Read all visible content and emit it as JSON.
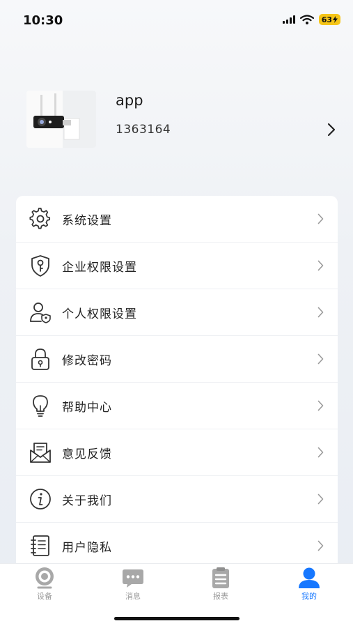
{
  "status_bar": {
    "time": "10:30",
    "battery": "63"
  },
  "profile": {
    "name": "app",
    "id": "1363164"
  },
  "menu": [
    {
      "label": "系统设置",
      "icon": "gear-icon"
    },
    {
      "label": "企业权限设置",
      "icon": "shield-key-icon"
    },
    {
      "label": "个人权限设置",
      "icon": "user-shield-icon"
    },
    {
      "label": "修改密码",
      "icon": "lock-icon"
    },
    {
      "label": "帮助中心",
      "icon": "lightbulb-icon"
    },
    {
      "label": "意见反馈",
      "icon": "mail-feedback-icon"
    },
    {
      "label": "关于我们",
      "icon": "info-icon"
    },
    {
      "label": "用户隐私",
      "icon": "notebook-icon"
    }
  ],
  "tabs": [
    {
      "label": "设备",
      "icon": "camera-icon",
      "active": false
    },
    {
      "label": "消息",
      "icon": "chat-icon",
      "active": false
    },
    {
      "label": "报表",
      "icon": "report-icon",
      "active": false
    },
    {
      "label": "我的",
      "icon": "user-icon",
      "active": true
    }
  ],
  "colors": {
    "accent": "#1677ff",
    "inactive": "#9a9a9a",
    "battery": "#f5c518"
  }
}
